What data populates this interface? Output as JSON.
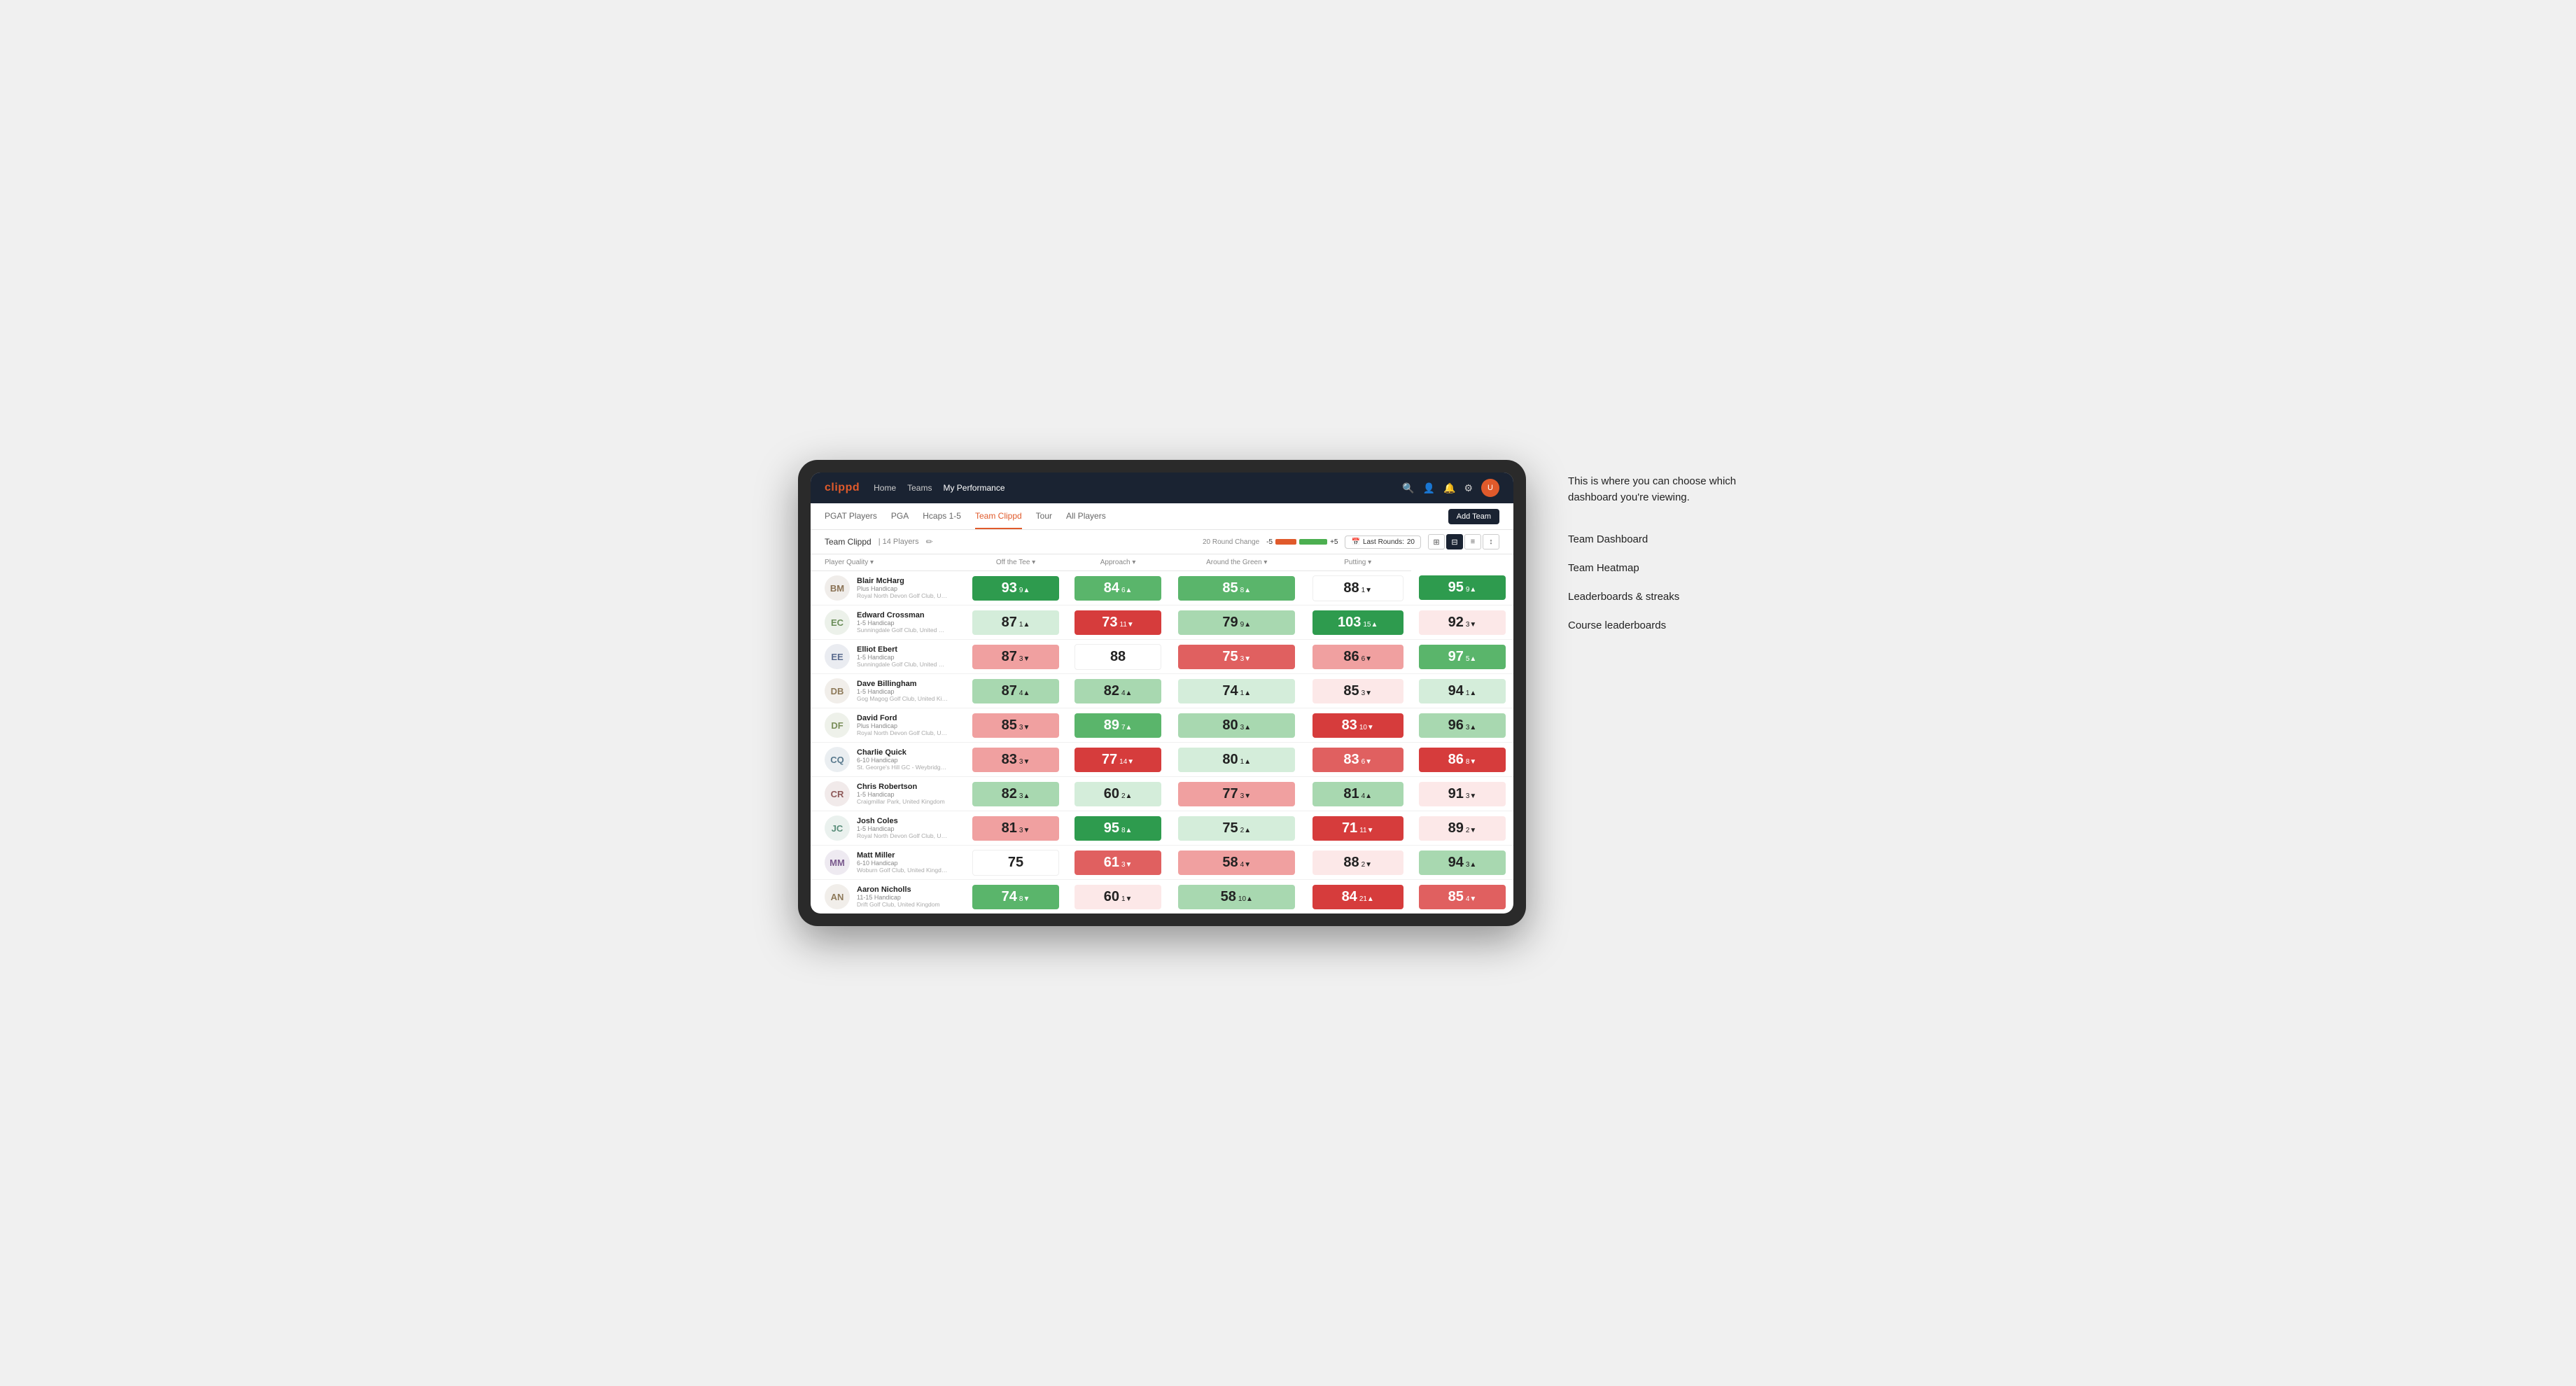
{
  "logo": "clippd",
  "nav": {
    "links": [
      "Home",
      "Teams",
      "My Performance"
    ],
    "active": "My Performance",
    "icons": [
      "search",
      "person",
      "bell",
      "settings",
      "avatar"
    ]
  },
  "subNav": {
    "links": [
      "PGAT Players",
      "PGA",
      "Hcaps 1-5",
      "Team Clippd",
      "Tour",
      "All Players"
    ],
    "active": "Team Clippd",
    "addTeamLabel": "Add Team"
  },
  "teamHeader": {
    "title": "Team Clippd",
    "separator": "|",
    "playerCount": "14 Players",
    "roundChangeLabel": "20 Round Change",
    "negLabel": "-5",
    "posLabel": "+5",
    "lastRoundsLabel": "Last Rounds:",
    "lastRoundsValue": "20"
  },
  "tableHeaders": {
    "player": "Player Quality ▾",
    "offTee": "Off the Tee ▾",
    "approach": "Approach ▾",
    "aroundGreen": "Around the Green ▾",
    "putting": "Putting ▾"
  },
  "players": [
    {
      "name": "Blair McHarg",
      "handicap": "Plus Handicap",
      "club": "Royal North Devon Golf Club, United Kingdom",
      "initials": "BM",
      "color": "#8B7355",
      "scores": {
        "quality": {
          "val": 93,
          "delta": "9",
          "dir": "up",
          "bg": "green-dark"
        },
        "offTee": {
          "val": 84,
          "delta": "6",
          "dir": "up",
          "bg": "green-mid"
        },
        "approach": {
          "val": 85,
          "delta": "8",
          "dir": "up",
          "bg": "green-mid"
        },
        "aroundGreen": {
          "val": 88,
          "delta": "1",
          "dir": "down",
          "bg": "white"
        },
        "putting": {
          "val": 95,
          "delta": "9",
          "dir": "up",
          "bg": "green-dark"
        }
      }
    },
    {
      "name": "Edward Crossman",
      "handicap": "1-5 Handicap",
      "club": "Sunningdale Golf Club, United Kingdom",
      "initials": "EC",
      "color": "#6B8E5A",
      "scores": {
        "quality": {
          "val": 87,
          "delta": "1",
          "dir": "up",
          "bg": "very-light-green"
        },
        "offTee": {
          "val": 73,
          "delta": "11",
          "dir": "down",
          "bg": "red-dark"
        },
        "approach": {
          "val": 79,
          "delta": "9",
          "dir": "up",
          "bg": "green-light"
        },
        "aroundGreen": {
          "val": 103,
          "delta": "15",
          "dir": "up",
          "bg": "green-dark"
        },
        "putting": {
          "val": 92,
          "delta": "3",
          "dir": "down",
          "bg": "very-light-red"
        }
      }
    },
    {
      "name": "Elliot Ebert",
      "handicap": "1-5 Handicap",
      "club": "Sunningdale Golf Club, United Kingdom",
      "initials": "EE",
      "color": "#5A6B8E",
      "scores": {
        "quality": {
          "val": 87,
          "delta": "3",
          "dir": "down",
          "bg": "red-light"
        },
        "offTee": {
          "val": 88,
          "delta": "",
          "dir": "",
          "bg": "white"
        },
        "approach": {
          "val": 75,
          "delta": "3",
          "dir": "down",
          "bg": "red-mid"
        },
        "aroundGreen": {
          "val": 86,
          "delta": "6",
          "dir": "down",
          "bg": "red-light"
        },
        "putting": {
          "val": 97,
          "delta": "5",
          "dir": "up",
          "bg": "green-mid"
        }
      }
    },
    {
      "name": "Dave Billingham",
      "handicap": "1-5 Handicap",
      "club": "Gog Magog Golf Club, United Kingdom",
      "initials": "DB",
      "color": "#8E7A5A",
      "scores": {
        "quality": {
          "val": 87,
          "delta": "4",
          "dir": "up",
          "bg": "green-light"
        },
        "offTee": {
          "val": 82,
          "delta": "4",
          "dir": "up",
          "bg": "green-light"
        },
        "approach": {
          "val": 74,
          "delta": "1",
          "dir": "up",
          "bg": "very-light-green"
        },
        "aroundGreen": {
          "val": 85,
          "delta": "3",
          "dir": "down",
          "bg": "very-light-red"
        },
        "putting": {
          "val": 94,
          "delta": "1",
          "dir": "up",
          "bg": "very-light-green"
        }
      }
    },
    {
      "name": "David Ford",
      "handicap": "Plus Handicap",
      "club": "Royal North Devon Golf Club, United Kingdom",
      "initials": "DF",
      "color": "#7A8E5A",
      "scores": {
        "quality": {
          "val": 85,
          "delta": "3",
          "dir": "down",
          "bg": "red-light"
        },
        "offTee": {
          "val": 89,
          "delta": "7",
          "dir": "up",
          "bg": "green-mid"
        },
        "approach": {
          "val": 80,
          "delta": "3",
          "dir": "up",
          "bg": "green-light"
        },
        "aroundGreen": {
          "val": 83,
          "delta": "10",
          "dir": "down",
          "bg": "red-dark"
        },
        "putting": {
          "val": 96,
          "delta": "3",
          "dir": "up",
          "bg": "green-light"
        }
      }
    },
    {
      "name": "Charlie Quick",
      "handicap": "6-10 Handicap",
      "club": "St. George's Hill GC - Weybridge - Surrey, Uni...",
      "initials": "CQ",
      "color": "#5A7A8E",
      "scores": {
        "quality": {
          "val": 83,
          "delta": "3",
          "dir": "down",
          "bg": "red-light"
        },
        "offTee": {
          "val": 77,
          "delta": "14",
          "dir": "down",
          "bg": "red-dark"
        },
        "approach": {
          "val": 80,
          "delta": "1",
          "dir": "up",
          "bg": "very-light-green"
        },
        "aroundGreen": {
          "val": 83,
          "delta": "6",
          "dir": "down",
          "bg": "red-mid"
        },
        "putting": {
          "val": 86,
          "delta": "8",
          "dir": "down",
          "bg": "red-dark"
        }
      }
    },
    {
      "name": "Chris Robertson",
      "handicap": "1-5 Handicap",
      "club": "Craigmillar Park, United Kingdom",
      "initials": "CR",
      "color": "#8E5A5A",
      "scores": {
        "quality": {
          "val": 82,
          "delta": "3",
          "dir": "up",
          "bg": "green-light"
        },
        "offTee": {
          "val": 60,
          "delta": "2",
          "dir": "up",
          "bg": "very-light-green"
        },
        "approach": {
          "val": 77,
          "delta": "3",
          "dir": "down",
          "bg": "red-light"
        },
        "aroundGreen": {
          "val": 81,
          "delta": "4",
          "dir": "up",
          "bg": "green-light"
        },
        "putting": {
          "val": 91,
          "delta": "3",
          "dir": "down",
          "bg": "very-light-red"
        }
      }
    },
    {
      "name": "Josh Coles",
      "handicap": "1-5 Handicap",
      "club": "Royal North Devon Golf Club, United Kingdom",
      "initials": "JC",
      "color": "#5A8E7A",
      "scores": {
        "quality": {
          "val": 81,
          "delta": "3",
          "dir": "down",
          "bg": "red-light"
        },
        "offTee": {
          "val": 95,
          "delta": "8",
          "dir": "up",
          "bg": "green-dark"
        },
        "approach": {
          "val": 75,
          "delta": "2",
          "dir": "up",
          "bg": "very-light-green"
        },
        "aroundGreen": {
          "val": 71,
          "delta": "11",
          "dir": "down",
          "bg": "red-dark"
        },
        "putting": {
          "val": 89,
          "delta": "2",
          "dir": "down",
          "bg": "very-light-red"
        }
      }
    },
    {
      "name": "Matt Miller",
      "handicap": "6-10 Handicap",
      "club": "Woburn Golf Club, United Kingdom",
      "initials": "MM",
      "color": "#7A5A8E",
      "scores": {
        "quality": {
          "val": 75,
          "delta": "",
          "dir": "",
          "bg": "white"
        },
        "offTee": {
          "val": 61,
          "delta": "3",
          "dir": "down",
          "bg": "red-mid"
        },
        "approach": {
          "val": 58,
          "delta": "4",
          "dir": "down",
          "bg": "red-light"
        },
        "aroundGreen": {
          "val": 88,
          "delta": "2",
          "dir": "down",
          "bg": "very-light-red"
        },
        "putting": {
          "val": 94,
          "delta": "3",
          "dir": "up",
          "bg": "green-light"
        }
      }
    },
    {
      "name": "Aaron Nicholls",
      "handicap": "11-15 Handicap",
      "club": "Drift Golf Club, United Kingdom",
      "initials": "AN",
      "color": "#8E7A5A",
      "scores": {
        "quality": {
          "val": 74,
          "delta": "8",
          "dir": "down",
          "bg": "green-mid"
        },
        "offTee": {
          "val": 60,
          "delta": "1",
          "dir": "down",
          "bg": "very-light-red"
        },
        "approach": {
          "val": 58,
          "delta": "10",
          "dir": "up",
          "bg": "green-light"
        },
        "aroundGreen": {
          "val": 84,
          "delta": "21",
          "dir": "up",
          "bg": "red-dark"
        },
        "putting": {
          "val": 85,
          "delta": "4",
          "dir": "down",
          "bg": "red-mid"
        }
      }
    }
  ],
  "annotation": {
    "intro": "This is where you can choose which dashboard you're viewing.",
    "items": [
      "Team Dashboard",
      "Team Heatmap",
      "Leaderboards & streaks",
      "Course leaderboards"
    ]
  }
}
